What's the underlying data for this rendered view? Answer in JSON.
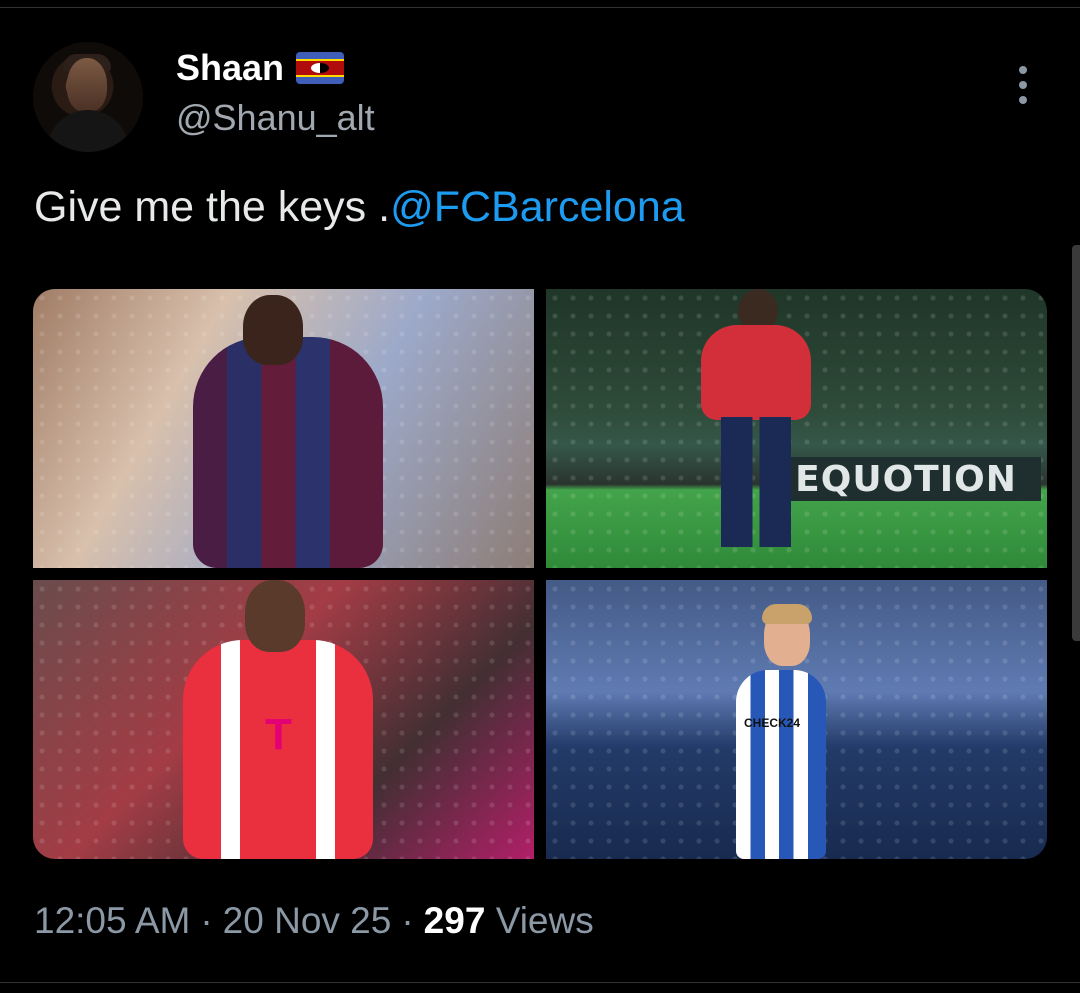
{
  "author": {
    "display_name": "Shaan",
    "handle": "@Shanu_alt",
    "flag_icon": "eswatini-flag-icon"
  },
  "tweet": {
    "text_prefix": "Give me the keys .",
    "mention": "@FCBarcelona"
  },
  "media": {
    "tile_3_sign": "EQUOTION",
    "tile_3_mark": "T",
    "tile_4_sponsor": "CHECK24"
  },
  "meta": {
    "time": "12:05 AM",
    "separator": "·",
    "date": "20 Nov 25",
    "view_count": "297",
    "views_label": "Views"
  },
  "colors": {
    "background": "#000000",
    "mention": "#1d9bf0",
    "secondary_text": "#8b98a5",
    "primary_text": "#e7e9ea"
  }
}
